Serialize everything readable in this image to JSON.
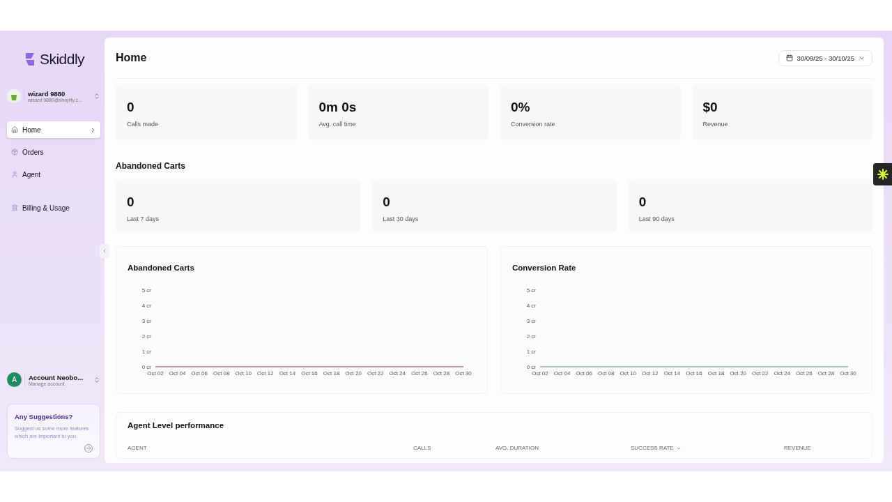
{
  "brand": {
    "name": "Skiddly"
  },
  "store": {
    "name": "wizard 9880",
    "email": "wizard 9880@shopify.c..."
  },
  "nav": [
    {
      "label": "Home",
      "selected": true
    },
    {
      "label": "Orders",
      "selected": false
    },
    {
      "label": "Agent",
      "selected": false
    },
    {
      "label": "Billing & Usage",
      "selected": false
    }
  ],
  "account": {
    "initial": "A",
    "name": "Account Neobo...",
    "subtitle": "Manage account"
  },
  "suggestions": {
    "title": "Any Suggestions?",
    "text": "Suggest us some more features which are important to you."
  },
  "page": {
    "title": "Home",
    "date_range": "30/09/25 - 30/10/25"
  },
  "stats": [
    {
      "value": "0",
      "label": "Calls made"
    },
    {
      "value": "0m 0s",
      "label": "Avg. call time"
    },
    {
      "value": "0%",
      "label": "Conversion rate"
    },
    {
      "value": "$0",
      "label": "Revenue"
    }
  ],
  "abandoned": {
    "title": "Abandoned Carts",
    "stats": [
      {
        "value": "0",
        "label": "Last 7 days"
      },
      {
        "value": "0",
        "label": "Last 30 days"
      },
      {
        "value": "0",
        "label": "Last 90 days"
      }
    ]
  },
  "charts": [
    {
      "title": "Abandoned Carts",
      "chart_data": {
        "type": "line",
        "categories": [
          "Oct 02",
          "Oct 04",
          "Oct 06",
          "Oct 08",
          "Oct 10",
          "Oct 12",
          "Oct 14",
          "Oct 16",
          "Oct 18",
          "Oct 20",
          "Oct 22",
          "Oct 24",
          "Oct 26",
          "Oct 28",
          "Oct 30"
        ],
        "series": [
          {
            "color": "#b07078",
            "values": [
              0,
              0,
              0,
              0,
              0,
              0,
              0,
              0,
              0,
              0,
              0,
              0,
              0,
              0,
              0
            ]
          }
        ],
        "ylim": [
          0,
          5
        ],
        "yticks": [
          {
            "value": 0,
            "label": "0 cr"
          },
          {
            "value": 1,
            "label": "1 cr"
          },
          {
            "value": 2,
            "label": "2 cr"
          },
          {
            "value": 3,
            "label": "3 cr"
          },
          {
            "value": 4,
            "label": "4 cr"
          },
          {
            "value": 5,
            "label": "5 cr"
          }
        ]
      }
    },
    {
      "title": "Conversion Rate",
      "chart_data": {
        "type": "line",
        "categories": [
          "Oct 02",
          "Oct 04",
          "Oct 06",
          "Oct 08",
          "Oct 10",
          "Oct 12",
          "Oct 14",
          "Oct 16",
          "Oct 18",
          "Oct 20",
          "Oct 22",
          "Oct 24",
          "Oct 26",
          "Oct 28",
          "Oct 30"
        ],
        "series": [
          {
            "color": "#8aaabb",
            "values": [
              0,
              0,
              0,
              0,
              0,
              0,
              0,
              0,
              0,
              0,
              0,
              0,
              0,
              0,
              0
            ]
          }
        ],
        "ylim": [
          0,
          5
        ],
        "yticks": [
          {
            "value": 0,
            "label": "0 cr"
          },
          {
            "value": 1,
            "label": "1 cr"
          },
          {
            "value": 2,
            "label": "2 cr"
          },
          {
            "value": 3,
            "label": "3 cr"
          },
          {
            "value": 4,
            "label": "4 cr"
          },
          {
            "value": 5,
            "label": "5 cr"
          }
        ]
      }
    }
  ],
  "agent_table": {
    "title": "Agent Level performance",
    "columns": [
      {
        "label": "AGENT",
        "sorted": false
      },
      {
        "label": "CALLS",
        "sorted": false
      },
      {
        "label": "AVG. DURATION",
        "sorted": false
      },
      {
        "label": "SUCCESS RATE",
        "sorted": true
      },
      {
        "label": "REVENUE",
        "sorted": false
      }
    ]
  }
}
